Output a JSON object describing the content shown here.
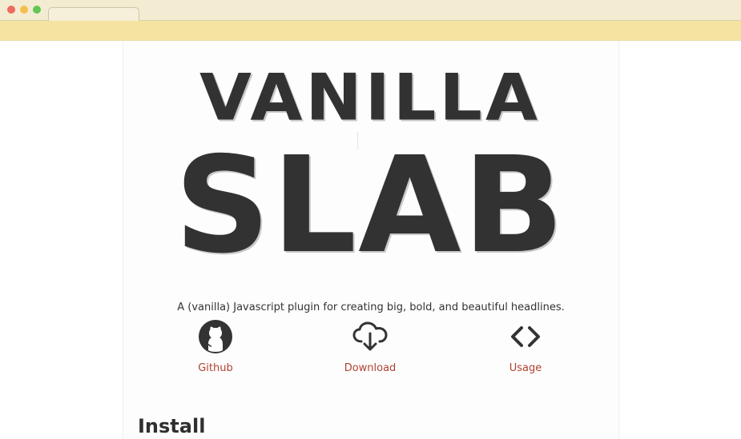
{
  "browser": {
    "window_controls": [
      "close",
      "minimize",
      "maximize"
    ],
    "active_tab_label": ""
  },
  "colors": {
    "titlebar": "#f4ecd2",
    "toolbar": "#f5e3a1",
    "headline": "#323232",
    "link": "#b04232",
    "text": "#333333"
  },
  "hero": {
    "headline_line1": "VANILLA",
    "headline_line2": "SLAB",
    "tagline": "A (vanilla) Javascript plugin for creating big, bold, and beautiful headlines."
  },
  "actions": [
    {
      "label": "Github",
      "icon": "github-icon"
    },
    {
      "label": "Download",
      "icon": "cloud-download-icon"
    },
    {
      "label": "Usage",
      "icon": "code-icon"
    }
  ],
  "sections": {
    "install_heading": "Install"
  }
}
